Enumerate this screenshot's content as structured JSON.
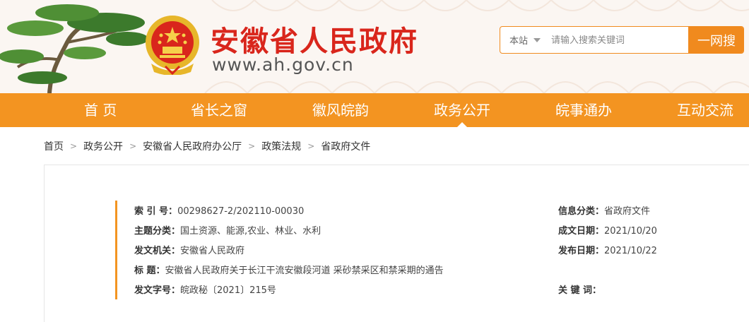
{
  "header": {
    "site_title": "安徽省人民政府",
    "site_url": "www.ah.gov.cn"
  },
  "search": {
    "scope": "本站",
    "placeholder": "请输入搜索关键词",
    "button_label": "一网搜"
  },
  "nav": {
    "items": [
      {
        "label": "首 页",
        "active": false
      },
      {
        "label": "省长之窗",
        "active": false
      },
      {
        "label": "徽风皖韵",
        "active": false
      },
      {
        "label": "政务公开",
        "active": true
      },
      {
        "label": "皖事通办",
        "active": false
      },
      {
        "label": "互动交流",
        "active": false
      }
    ]
  },
  "breadcrumb": [
    "首页",
    "政务公开",
    "安徽省人民政府办公厅",
    "政策法规",
    "省政府文件"
  ],
  "meta": {
    "index_label": "索  引  号：",
    "index_value": "00298627-2/202110-00030",
    "category_label": "信息分类：",
    "category_value": "省政府文件",
    "topic_label": "主题分类：",
    "topic_value": "国土资源、能源,农业、林业、水利",
    "created_label": "成文日期：",
    "created_value": "2021/10/20",
    "issuer_label": "发文机关：",
    "issuer_value": "安徽省人民政府",
    "published_label": "发布日期：",
    "published_value": "2021/10/22",
    "title_label": "标      题：",
    "title_value": "安徽省人民政府关于长江干流安徽段河道 采砂禁采区和禁采期的通告",
    "docno_label": "发文字号：",
    "docno_value": "皖政秘〔2021〕215号",
    "keywords_label": "关  键  词：",
    "keywords_value": ""
  },
  "colors": {
    "brand_red": "#d9261c",
    "nav_orange": "#f39421",
    "search_orange": "#f08a1e"
  }
}
